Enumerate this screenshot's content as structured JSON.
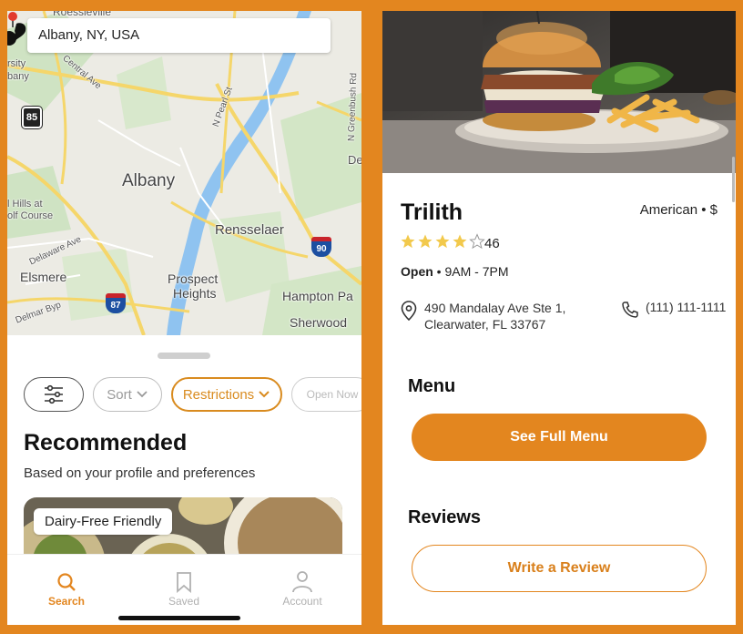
{
  "left": {
    "search": {
      "value": "Albany, NY, USA"
    },
    "map_labels": {
      "albany": "Albany",
      "rensselaer": "Rensselaer",
      "elsmere": "Elsmere",
      "prospect": "Prospect",
      "heights": "Heights",
      "hampton": "Hampton Pa",
      "sherwood": "Sherwood",
      "pearl": "N Pearl St",
      "greenbush": "N Greenbush Rd",
      "delaware": "Delaware Ave",
      "delmar": "Delmar Byp",
      "central": "Central Ave",
      "hills": "l Hills at",
      "golf": "olf Course",
      "rsity": "rsity",
      "bany": "bany",
      "de": "De",
      "roessleville": "Roessleville",
      "shield_85": "85",
      "shield_90": "90",
      "shield_87": "87"
    },
    "chips": {
      "sort": "Sort",
      "restrictions": "Restrictions",
      "open_now": "Open Now"
    },
    "recommended": {
      "title": "Recommended",
      "subtitle": "Based on your profile and preferences",
      "card_badge": "Dairy-Free Friendly"
    },
    "tabs": {
      "search": "Search",
      "saved": "Saved",
      "account": "Account"
    },
    "colors": {
      "accent": "#e3861f"
    }
  },
  "right": {
    "restaurant": {
      "name": "Trilith",
      "cuisine": "American • $",
      "rating": 4,
      "rating_max": 5,
      "review_count": "46",
      "status": "Open",
      "hours": "• 9AM - 7PM",
      "address_line1": "490 Mandalay Ave Ste 1,",
      "address_line2": "Clearwater, FL 33767",
      "phone": "(111) 111-1111"
    },
    "menu": {
      "title": "Menu",
      "button": "See Full Menu"
    },
    "reviews": {
      "title": "Reviews",
      "button": "Write a Review"
    }
  }
}
